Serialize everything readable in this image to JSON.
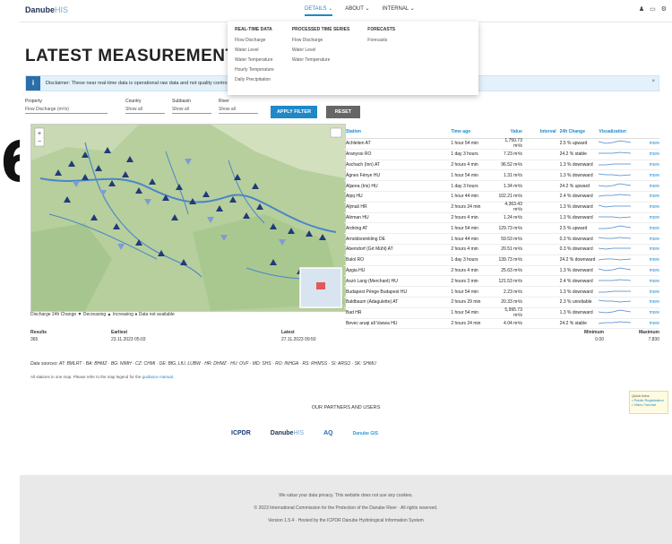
{
  "side_fragment": "6",
  "header": {
    "logo": "Danube",
    "logo_suffix": "HIS",
    "nav": [
      "DETAILS ⌄",
      "ABOUT ⌄",
      "INTERNAL ⌄"
    ],
    "icons": [
      "user-icon",
      "language-icon",
      "settings-icon"
    ],
    "icon_glyphs": [
      "♟",
      "▭",
      "⚙"
    ]
  },
  "dropdown": {
    "columns": [
      {
        "title": "REAL-TIME DATA",
        "items": [
          "Flow Discharge",
          "Water Level",
          "Water Temperature",
          "Hourly Temperature",
          "Daily Precipitation"
        ]
      },
      {
        "title": "PROCESSED TIME SERIES",
        "items": [
          "Flow Discharge",
          "Water Level",
          "Water Temperature"
        ]
      },
      {
        "title": "FORECASTS",
        "items": [
          "Forecasts"
        ]
      }
    ]
  },
  "title": "LATEST MEASUREMENTS",
  "disclaimer": {
    "text": "Disclaimer: These near real-time data is operational raw data and not quality controlled.",
    "close": "×"
  },
  "filters": {
    "property": {
      "label": "Property",
      "value": "Flow Discharge (m³/s)"
    },
    "country": {
      "label": "Country",
      "value": "Show all"
    },
    "subbasin": {
      "label": "Subbasin",
      "value": "Show all"
    },
    "river": {
      "label": "River",
      "value": "Show all"
    },
    "extra": {
      "label": "",
      "value": "Show all"
    },
    "apply": "APPLY FILTER",
    "reset": "RESET"
  },
  "map": {
    "legend": "Discharge 24h Change ▼ Decreasing ▲ Increasing ● Data not available"
  },
  "table": {
    "headers": [
      "Station",
      "Time ago",
      "Value",
      "Interval",
      "24h Change",
      "Visualization",
      ""
    ],
    "rows": [
      [
        "Achleiten AT",
        "1 hour 54 min",
        "1,750.73 m³/s",
        "",
        "2.5 % upward",
        "",
        "more"
      ],
      [
        "Aranyosi RO",
        "1 day 3 hours",
        "7.23 m³/s",
        "",
        "24.2 % stable",
        "",
        "more"
      ],
      [
        "Aschach (Inn) AT",
        "2 hours 4 min",
        "96.52 m³/s",
        "",
        "1.3 % downward",
        "",
        "more"
      ],
      [
        "Ágnes Fénye HU",
        "1 hour 54 min",
        "1.31 m³/s",
        "",
        "1.3 % downward",
        "",
        "more"
      ],
      [
        "Aljarea (Iris) HU",
        "1 day 3 hours",
        "1.34 m³/s",
        "",
        "24.2 % upward",
        "",
        "more"
      ],
      [
        "Alpq HU",
        "1 hour 44 min",
        "102.21 m³/s",
        "",
        "2.4 % downward",
        "",
        "more"
      ],
      [
        "Aljmaš HR",
        "2 hours 24 min",
        "4,363.43 m³/s",
        "",
        "1.3 % downward",
        "",
        "more"
      ],
      [
        "Alirman HU",
        "2 hours 4 min",
        "1.24 m³/s",
        "",
        "1.3 % downward",
        "",
        "more"
      ],
      [
        "Ardning AT",
        "1 hour 54 min",
        "129.73 m³/s",
        "",
        "2.5 % upward",
        "",
        "more"
      ],
      [
        "Arnoldsreinkling DE",
        "1 hour 44 min",
        "59.53 m³/s",
        "",
        "0.3 % downward",
        "",
        "more"
      ],
      [
        "Abemdorf (Grt Mühl) AT",
        "2 hours 4 min",
        "20.51 m³/s",
        "",
        "0.3 % downward",
        "",
        "more"
      ],
      [
        "Balol RO",
        "1 day 3 hours",
        "139.73 m³/s",
        "",
        "24.2 % downward",
        "",
        "more"
      ],
      [
        "Ápgia HU",
        "2 hours 4 min",
        "25.63 m³/s",
        "",
        "1.3 % downward",
        "",
        "more"
      ],
      [
        "Aszó Lang (Merchant) HU",
        "2 hours 3 min",
        "121.53 m³/s",
        "",
        "2.4 % downward",
        "",
        "more"
      ],
      [
        "Budapest Pénge Budapest HU",
        "1 hour 54 min",
        "2.23 m³/s",
        "",
        "1.3 % downward",
        "",
        "more"
      ],
      [
        "Baldbaum (Adagulette) AT",
        "2 hours 29 min",
        "20.33 m³/s",
        "",
        "2.3 % unreliable",
        "",
        "more"
      ],
      [
        "Bad HR",
        "1 hour 54 min",
        "5,995.73 m³/s",
        "",
        "1.3 % downward",
        "",
        "more"
      ],
      [
        "Bevec aruqi all Vaswa HU",
        "2 hours 24 min",
        "4.04 m³/s",
        "",
        "24.2 % stable",
        "",
        "more"
      ]
    ]
  },
  "stats": {
    "headers": [
      "Results",
      "Earliest",
      "Latest",
      "Minimum",
      "Maximum"
    ],
    "values": [
      "365",
      "23.11.2023 05:03",
      "27.11.2023 09:50",
      "0.00",
      "7,830"
    ]
  },
  "stations_line": "Data sources: AT: BMLRT · BA: BHMZ · BG: NIMH · CZ: CHMI · DE: BfG, LfU, LUBW · HR: DHMZ · HU: OVF · MD: SHS · RO: INHGA · RS: RHMSS · SI: ARSO · SK: SHMU",
  "note": {
    "text": "All stations in one map. Please refer to the map legend for the",
    "link": "guidance manual."
  },
  "partners_title": "OUR PARTNERS AND USERS",
  "partner_logos": [
    "ICPDR",
    "Danube",
    "HIS",
    "AQ",
    "Danube GIS"
  ],
  "sidebox": {
    "title": "Quick links:",
    "links": [
      "• Public Registration",
      "• Video Tutorial"
    ]
  },
  "footer": {
    "lines": [
      "We value your data privacy. This website does not use any cookies.",
      "© 2023 International Commission for the Protection of the Danube River · All rights reserved.",
      "Version 1.5.4 · Hosted by the ICPDR Danube Hydrological Information System"
    ]
  }
}
